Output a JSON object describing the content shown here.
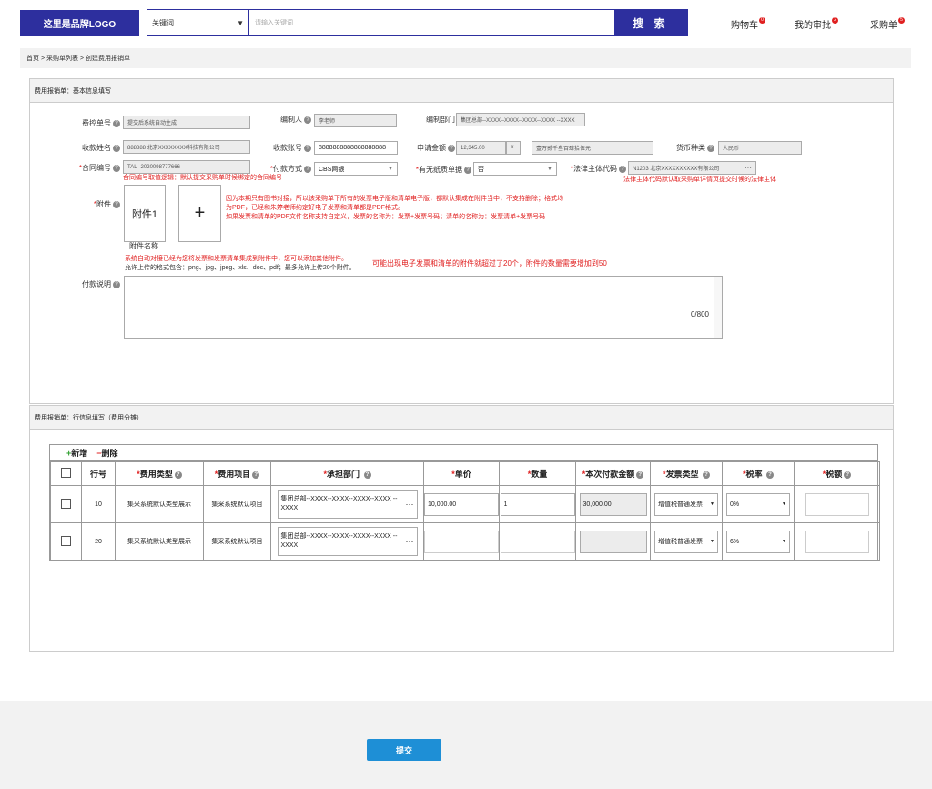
{
  "header": {
    "logo": "这里是品牌LOGO",
    "keyword_select": "关键词",
    "search_placeholder": "请输入关键词",
    "search_button": "搜 索",
    "nav": [
      {
        "label": "购物车",
        "badge": "0"
      },
      {
        "label": "我的审批",
        "badge": "2"
      },
      {
        "label": "采购单",
        "badge": "5"
      }
    ]
  },
  "breadcrumb": "首页 > 采购单列表 > 创建费用报销单",
  "basic": {
    "title": "费用报销单：基本信息填写",
    "fee_no_label": "费控单号",
    "fee_no": "提交后系统自动生成",
    "editor_label": "编制人",
    "editor": "李老师",
    "dept_label": "编制部门",
    "dept": "集团总部--XXXX--XXXX--XXXX--XXXX --XXXX",
    "payee_name_label": "收款姓名",
    "payee_name": "888888 北京XXXXXXXX科技有限公司",
    "payee_account_label": "收款账号",
    "payee_account": "8888888888888888888",
    "amount_label": "申请金额",
    "amount": "12,345.00",
    "amount_unit": "¥",
    "amount_upper": "壹万贰千叁百肆拾伍元",
    "currency_label": "货币种类",
    "currency": "人民币",
    "contract_label": "合同编号",
    "contract": "TAL--2020098777666",
    "contract_note": "合同编号取值逻辑：默认提交采购单时候绑定的合同编号",
    "pay_method_label": "付款方式",
    "pay_method": "CBS网银",
    "paper_label": "有无纸质单据",
    "paper": "否",
    "legal_label": "法律主体代码",
    "legal": "N1203 北京XXXXXXXXXX有限公司",
    "legal_note": "法律主体代码默认取采购单详情页提交时候的法律主体",
    "attach_label": "附件",
    "attach_item": "附件1",
    "attach_add": "+",
    "attach_name": "附件名称...",
    "attach_note1": "因为本期只有图书对接，所以该采购单下所有的发票电子版和清单电子版，都默认集成在附件当中，不支持删除；格式均",
    "attach_note2": "为PDF，已经和朱婷老师约定好电子发票和清单都是PDF格式。",
    "attach_note3": "如果发票和清单的PDF文件名称支持自定义，发票的名称为：发票+发票号码；清单的名称为：发票清单+发票号码",
    "auto_note": "系统自动对接已经为您将发票和发票清单集成到附件中，您可以添加其他附件。",
    "allowed_formats": "允许上传的格式包含：png、jpg、jpeg、xls、doc、pdf；最多允许上传20个附件。",
    "limit_note": "可能出现电子发票和清单的附件就超过了20个，附件的数量需要增加到50",
    "pay_desc_label": "付款说明",
    "pay_desc_counter": "0/800"
  },
  "lines": {
    "title": "费用报销单：行信息填写（费用分摊）",
    "add": "新增",
    "delete": "删除",
    "columns": [
      "行号",
      "费用类型",
      "费用项目",
      "承担部门",
      "单价",
      "数量",
      "本次付款金额",
      "发票类型",
      "税率",
      "税额"
    ],
    "rows": [
      {
        "no": "10",
        "fee_type": "集采系统默认类型展示",
        "fee_item": "集采系统默认项目",
        "dept": "集团总部--XXXX--XXXX--XXXX--XXXX --XXXX",
        "price": "10,000.00",
        "qty": "1",
        "amount": "30,000.00",
        "invoice_type": "增值税普通发票",
        "tax_rate": "0%",
        "tax": ""
      },
      {
        "no": "20",
        "fee_type": "集采系统默认类型展示",
        "fee_item": "集采系统默认项目",
        "dept": "集团总部--XXXX--XXXX--XXXX--XXXX --XXXX",
        "price": "",
        "qty": "",
        "amount": "",
        "invoice_type": "增值税普通发票",
        "tax_rate": "6%",
        "tax": ""
      }
    ]
  },
  "submit": "提交"
}
